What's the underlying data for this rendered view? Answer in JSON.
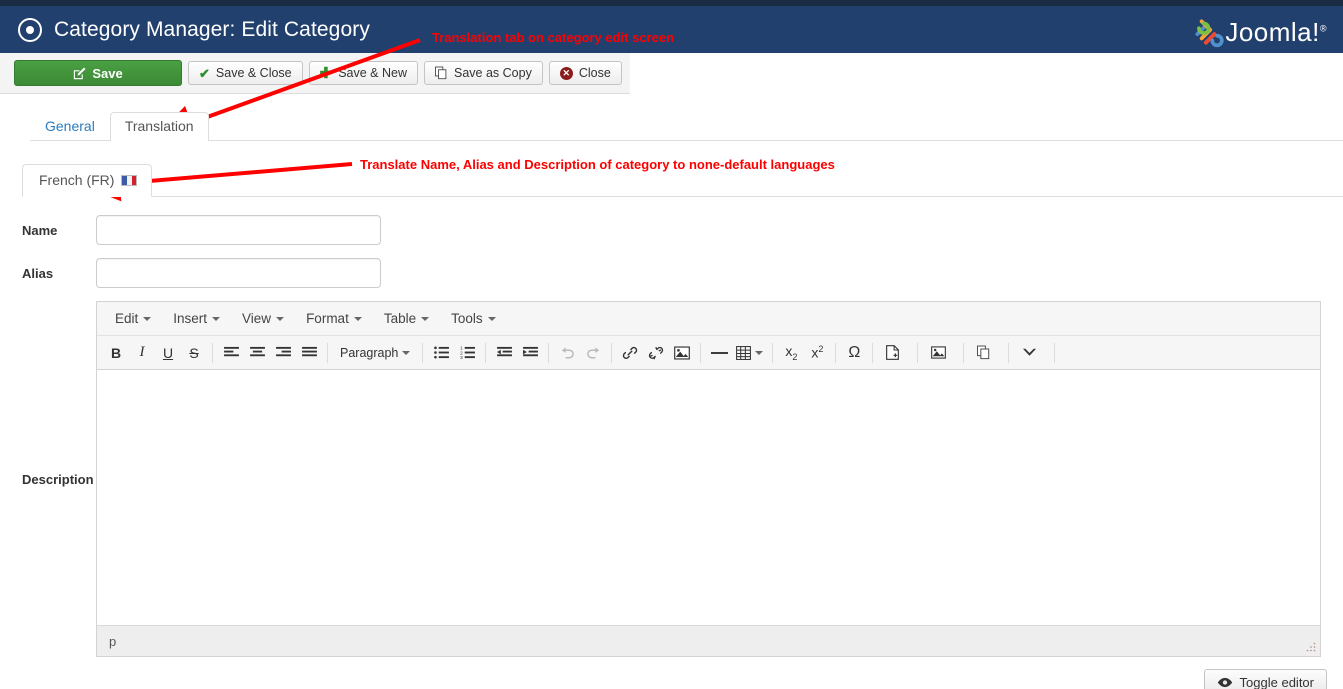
{
  "header": {
    "title": "Category Manager: Edit Category",
    "icon": "target-circle-icon",
    "brand": "Joomla!",
    "brand_mark": "®",
    "bg_color": "#22406e",
    "top_strip_color": "#1a2b44"
  },
  "toolbar": {
    "buttons": [
      {
        "label": "Save",
        "icon": "pencil-square-icon",
        "primary": true
      },
      {
        "label": "Save & Close",
        "icon": "check-icon",
        "primary": false
      },
      {
        "label": "Save & New",
        "icon": "plus-icon",
        "primary": false
      },
      {
        "label": "Save as Copy",
        "icon": "copy-icon",
        "primary": false
      },
      {
        "label": "Close",
        "icon": "circle-x-icon",
        "primary": false
      }
    ]
  },
  "tabs": [
    {
      "label": "General",
      "active": false
    },
    {
      "label": "Translation",
      "active": true
    }
  ],
  "language_tabs": [
    {
      "label": "French (FR)",
      "flag": "flag-fr-icon",
      "active": true
    }
  ],
  "form": {
    "name": {
      "label": "Name",
      "value": "",
      "placeholder": ""
    },
    "alias": {
      "label": "Alias",
      "value": "",
      "placeholder": ""
    },
    "description": {
      "label": "Description"
    }
  },
  "editor": {
    "menubar": [
      "Edit",
      "Insert",
      "View",
      "Format",
      "Table",
      "Tools"
    ],
    "toolbar": [
      {
        "name": "bold-icon",
        "glyph": "B",
        "style": "bold"
      },
      {
        "name": "italic-icon",
        "glyph": "I",
        "style": "italic"
      },
      {
        "name": "underline-icon",
        "glyph": "U",
        "style": "underline"
      },
      {
        "name": "strikethrough-icon",
        "glyph": "S",
        "style": "strike"
      },
      {
        "name": "separator",
        "glyph": "",
        "style": "sep"
      },
      {
        "name": "align-left-icon",
        "glyph": "",
        "style": "align-left"
      },
      {
        "name": "align-center-icon",
        "glyph": "",
        "style": "align-center"
      },
      {
        "name": "align-right-icon",
        "glyph": "",
        "style": "align-right"
      },
      {
        "name": "align-justify-icon",
        "glyph": "",
        "style": "align-justify"
      },
      {
        "name": "separator",
        "glyph": "",
        "style": "sep"
      },
      {
        "name": "paragraph-format-dropdown",
        "glyph": "Paragraph",
        "style": "dropdown"
      },
      {
        "name": "separator",
        "glyph": "",
        "style": "sep"
      },
      {
        "name": "bullet-list-icon",
        "glyph": "",
        "style": "ul"
      },
      {
        "name": "numbered-list-icon",
        "glyph": "",
        "style": "ol"
      },
      {
        "name": "separator",
        "glyph": "",
        "style": "sep"
      },
      {
        "name": "outdent-icon",
        "glyph": "",
        "style": "outdent"
      },
      {
        "name": "indent-icon",
        "glyph": "",
        "style": "indent"
      },
      {
        "name": "separator",
        "glyph": "",
        "style": "sep"
      },
      {
        "name": "undo-icon",
        "glyph": "↺",
        "style": "disabled"
      },
      {
        "name": "redo-icon",
        "glyph": "↻",
        "style": "disabled"
      },
      {
        "name": "separator",
        "glyph": "",
        "style": "sep"
      },
      {
        "name": "link-icon",
        "glyph": "",
        "style": "link"
      },
      {
        "name": "unlink-icon",
        "glyph": "",
        "style": "unlink"
      },
      {
        "name": "insert-image-icon",
        "glyph": "",
        "style": "img"
      },
      {
        "name": "separator",
        "glyph": "",
        "style": "sep"
      },
      {
        "name": "horizontal-rule-icon",
        "glyph": "—",
        "style": "hr"
      },
      {
        "name": "insert-table-dropdown",
        "glyph": "",
        "style": "table"
      },
      {
        "name": "separator",
        "glyph": "",
        "style": "sep"
      },
      {
        "name": "subscript-icon",
        "glyph": "x₂",
        "style": "plain"
      },
      {
        "name": "superscript-icon",
        "glyph": "x²",
        "style": "plain"
      },
      {
        "name": "separator",
        "glyph": "",
        "style": "sep"
      },
      {
        "name": "special-character-icon",
        "glyph": "Ω",
        "style": "plain"
      },
      {
        "name": "separator",
        "glyph": "",
        "style": "sep"
      },
      {
        "name": "insert-article-button",
        "glyph": "Article",
        "style": "labeled-page"
      },
      {
        "name": "separator",
        "glyph": "",
        "style": "sep"
      },
      {
        "name": "insert-image-button",
        "glyph": "Image",
        "style": "labeled-image"
      },
      {
        "name": "separator",
        "glyph": "",
        "style": "sep"
      },
      {
        "name": "page-break-button",
        "glyph": "Page Break",
        "style": "labeled-copy"
      },
      {
        "name": "separator",
        "glyph": "",
        "style": "sep"
      },
      {
        "name": "read-more-button",
        "glyph": "Read More",
        "style": "labeled-chevron"
      },
      {
        "name": "separator",
        "glyph": "",
        "style": "sep"
      },
      {
        "name": "source-code-button",
        "glyph": "<>",
        "style": "plain"
      }
    ],
    "content": "",
    "statusbar_path": "p"
  },
  "footer": {
    "toggle_editor": {
      "label": "Toggle editor",
      "icon": "eye-icon"
    }
  },
  "annotations": [
    {
      "text": "Translation tab on category edit screen",
      "color": "#ff0000"
    },
    {
      "text": "Translate Name, Alias and Description of category to none-default languages",
      "color": "#ff0000"
    }
  ]
}
